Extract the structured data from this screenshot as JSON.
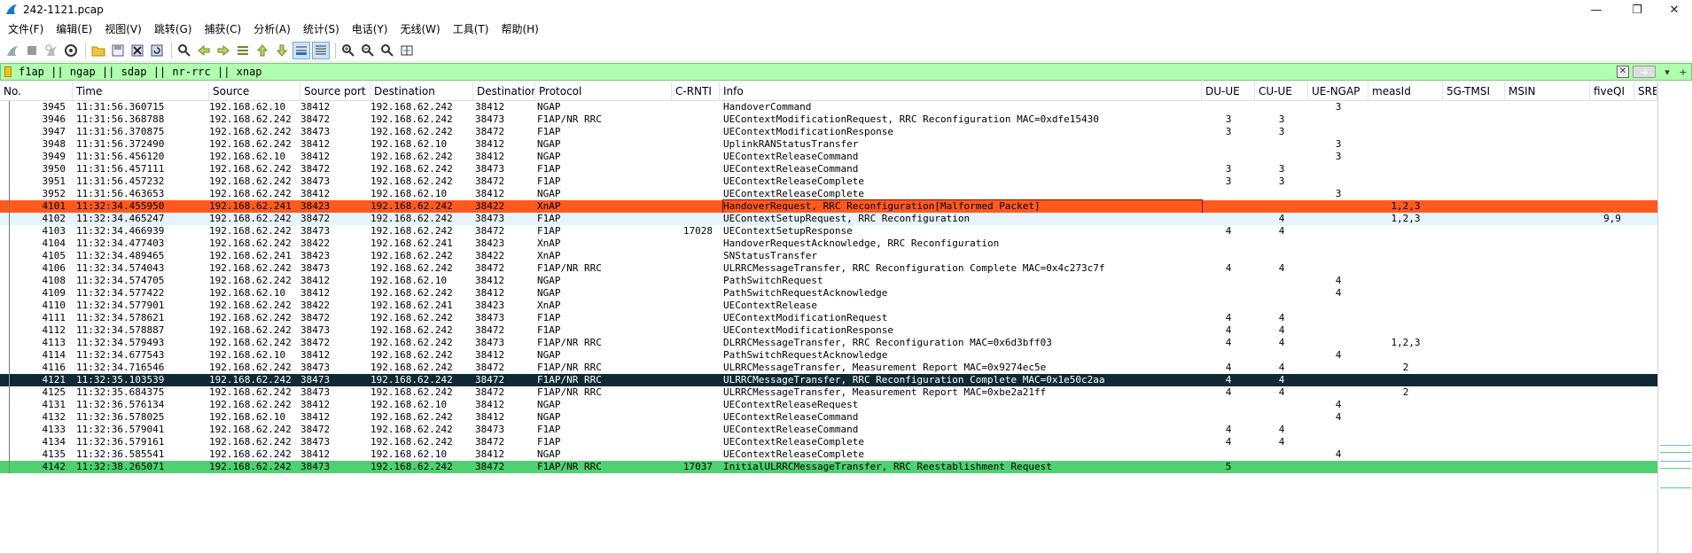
{
  "window": {
    "title": "242-1121.pcap",
    "minimize": "—",
    "restore": "❐",
    "close": "✕"
  },
  "menu": [
    "文件(F)",
    "编辑(E)",
    "视图(V)",
    "跳转(G)",
    "捕获(C)",
    "分析(A)",
    "统计(S)",
    "电话(Y)",
    "无线(W)",
    "工具(T)",
    "帮助(H)"
  ],
  "filter": {
    "value": "f1ap || ngap || sdap || nr-rrc || xnap",
    "background": "#afffaf"
  },
  "columns": [
    "No.",
    "Time",
    "Source",
    "Source port",
    "Destination",
    "Destination",
    "Protocol",
    "C-RNTI",
    "Info",
    "DU-UE",
    "CU-UE",
    "UE-NGAP",
    "measId",
    "5G-TMSI",
    "MSIN",
    "fiveQI",
    "SRB"
  ],
  "rows": [
    {
      "no": "3945",
      "time": "11:31:56.360715",
      "src": "192.168.62.10",
      "sport": "38412",
      "dst": "192.168.62.242",
      "dport": "38412",
      "proto": "NGAP",
      "crnti": "",
      "info": "HandoverCommand",
      "du": "",
      "cu": "",
      "ngap": "3",
      "meas": "",
      "tmsi": "",
      "msin": "",
      "fiveqi": "",
      "srb": "",
      "style": "normal"
    },
    {
      "no": "3946",
      "time": "11:31:56.368788",
      "src": "192.168.62.242",
      "sport": "38472",
      "dst": "192.168.62.242",
      "dport": "38473",
      "proto": "F1AP/NR RRC",
      "crnti": "",
      "info": "UEContextModificationRequest, RRC Reconfiguration MAC=0xdfe15430",
      "du": "3",
      "cu": "3",
      "ngap": "",
      "meas": "",
      "tmsi": "",
      "msin": "",
      "fiveqi": "",
      "srb": "",
      "style": "normal"
    },
    {
      "no": "3947",
      "time": "11:31:56.370875",
      "src": "192.168.62.242",
      "sport": "38473",
      "dst": "192.168.62.242",
      "dport": "38472",
      "proto": "F1AP",
      "crnti": "",
      "info": "UEContextModificationResponse",
      "du": "3",
      "cu": "3",
      "ngap": "",
      "meas": "",
      "tmsi": "",
      "msin": "",
      "fiveqi": "",
      "srb": "",
      "style": "normal"
    },
    {
      "no": "3948",
      "time": "11:31:56.372490",
      "src": "192.168.62.242",
      "sport": "38412",
      "dst": "192.168.62.10",
      "dport": "38412",
      "proto": "NGAP",
      "crnti": "",
      "info": "UplinkRANStatusTransfer",
      "du": "",
      "cu": "",
      "ngap": "3",
      "meas": "",
      "tmsi": "",
      "msin": "",
      "fiveqi": "",
      "srb": "",
      "style": "normal"
    },
    {
      "no": "3949",
      "time": "11:31:56.456120",
      "src": "192.168.62.10",
      "sport": "38412",
      "dst": "192.168.62.242",
      "dport": "38412",
      "proto": "NGAP",
      "crnti": "",
      "info": "UEContextReleaseCommand",
      "du": "",
      "cu": "",
      "ngap": "3",
      "meas": "",
      "tmsi": "",
      "msin": "",
      "fiveqi": "",
      "srb": "",
      "style": "normal"
    },
    {
      "no": "3950",
      "time": "11:31:56.457111",
      "src": "192.168.62.242",
      "sport": "38472",
      "dst": "192.168.62.242",
      "dport": "38473",
      "proto": "F1AP",
      "crnti": "",
      "info": "UEContextReleaseCommand",
      "du": "3",
      "cu": "3",
      "ngap": "",
      "meas": "",
      "tmsi": "",
      "msin": "",
      "fiveqi": "",
      "srb": "",
      "style": "normal"
    },
    {
      "no": "3951",
      "time": "11:31:56.457232",
      "src": "192.168.62.242",
      "sport": "38473",
      "dst": "192.168.62.242",
      "dport": "38472",
      "proto": "F1AP",
      "crnti": "",
      "info": "UEContextReleaseComplete",
      "du": "3",
      "cu": "3",
      "ngap": "",
      "meas": "",
      "tmsi": "",
      "msin": "",
      "fiveqi": "",
      "srb": "",
      "style": "normal"
    },
    {
      "no": "3952",
      "time": "11:31:56.463653",
      "src": "192.168.62.242",
      "sport": "38412",
      "dst": "192.168.62.10",
      "dport": "38412",
      "proto": "NGAP",
      "crnti": "",
      "info": "UEContextReleaseComplete",
      "du": "",
      "cu": "",
      "ngap": "3",
      "meas": "",
      "tmsi": "",
      "msin": "",
      "fiveqi": "",
      "srb": "",
      "style": "normal"
    },
    {
      "no": "4101",
      "time": "11:32:34.455950",
      "src": "192.168.62.241",
      "sport": "38423",
      "dst": "192.168.62.242",
      "dport": "38422",
      "proto": "XnAP",
      "crnti": "",
      "info": "HandoverRequest, RRC Reconfiguration[Malformed Packet]",
      "du": "",
      "cu": "",
      "ngap": "",
      "meas": "1,2,3",
      "tmsi": "",
      "msin": "",
      "fiveqi": "",
      "srb": "",
      "style": "orange"
    },
    {
      "no": "4102",
      "time": "11:32:34.465247",
      "src": "192.168.62.242",
      "sport": "38472",
      "dst": "192.168.62.242",
      "dport": "38473",
      "proto": "F1AP",
      "crnti": "",
      "info": "UEContextSetupRequest, RRC Reconfiguration",
      "du": "",
      "cu": "4",
      "ngap": "",
      "meas": "1,2,3",
      "tmsi": "",
      "msin": "",
      "fiveqi": "9,9",
      "srb": "",
      "style": "lightblue"
    },
    {
      "no": "4103",
      "time": "11:32:34.466939",
      "src": "192.168.62.242",
      "sport": "38473",
      "dst": "192.168.62.242",
      "dport": "38472",
      "proto": "F1AP",
      "crnti": "17028",
      "info": "UEContextSetupResponse",
      "du": "4",
      "cu": "4",
      "ngap": "",
      "meas": "",
      "tmsi": "",
      "msin": "",
      "fiveqi": "",
      "srb": "",
      "style": "normal"
    },
    {
      "no": "4104",
      "time": "11:32:34.477403",
      "src": "192.168.62.242",
      "sport": "38422",
      "dst": "192.168.62.241",
      "dport": "38423",
      "proto": "XnAP",
      "crnti": "",
      "info": "HandoverRequestAcknowledge, RRC Reconfiguration",
      "du": "",
      "cu": "",
      "ngap": "",
      "meas": "",
      "tmsi": "",
      "msin": "",
      "fiveqi": "",
      "srb": "",
      "style": "normal"
    },
    {
      "no": "4105",
      "time": "11:32:34.489465",
      "src": "192.168.62.241",
      "sport": "38423",
      "dst": "192.168.62.242",
      "dport": "38422",
      "proto": "XnAP",
      "crnti": "",
      "info": "SNStatusTransfer",
      "du": "",
      "cu": "",
      "ngap": "",
      "meas": "",
      "tmsi": "",
      "msin": "",
      "fiveqi": "",
      "srb": "",
      "style": "normal"
    },
    {
      "no": "4106",
      "time": "11:32:34.574043",
      "src": "192.168.62.242",
      "sport": "38473",
      "dst": "192.168.62.242",
      "dport": "38472",
      "proto": "F1AP/NR RRC",
      "crnti": "",
      "info": "ULRRCMessageTransfer, RRC Reconfiguration Complete MAC=0x4c273c7f",
      "du": "4",
      "cu": "4",
      "ngap": "",
      "meas": "",
      "tmsi": "",
      "msin": "",
      "fiveqi": "",
      "srb": "",
      "style": "normal"
    },
    {
      "no": "4108",
      "time": "11:32:34.574705",
      "src": "192.168.62.242",
      "sport": "38412",
      "dst": "192.168.62.10",
      "dport": "38412",
      "proto": "NGAP",
      "crnti": "",
      "info": "PathSwitchRequest",
      "du": "",
      "cu": "",
      "ngap": "4",
      "meas": "",
      "tmsi": "",
      "msin": "",
      "fiveqi": "",
      "srb": "",
      "style": "normal"
    },
    {
      "no": "4109",
      "time": "11:32:34.577422",
      "src": "192.168.62.10",
      "sport": "38412",
      "dst": "192.168.62.242",
      "dport": "38412",
      "proto": "NGAP",
      "crnti": "",
      "info": "PathSwitchRequestAcknowledge",
      "du": "",
      "cu": "",
      "ngap": "4",
      "meas": "",
      "tmsi": "",
      "msin": "",
      "fiveqi": "",
      "srb": "",
      "style": "normal"
    },
    {
      "no": "4110",
      "time": "11:32:34.577901",
      "src": "192.168.62.242",
      "sport": "38422",
      "dst": "192.168.62.241",
      "dport": "38423",
      "proto": "XnAP",
      "crnti": "",
      "info": "UEContextRelease",
      "du": "",
      "cu": "",
      "ngap": "",
      "meas": "",
      "tmsi": "",
      "msin": "",
      "fiveqi": "",
      "srb": "",
      "style": "normal"
    },
    {
      "no": "4111",
      "time": "11:32:34.578621",
      "src": "192.168.62.242",
      "sport": "38472",
      "dst": "192.168.62.242",
      "dport": "38473",
      "proto": "F1AP",
      "crnti": "",
      "info": "UEContextModificationRequest",
      "du": "4",
      "cu": "4",
      "ngap": "",
      "meas": "",
      "tmsi": "",
      "msin": "",
      "fiveqi": "",
      "srb": "",
      "style": "normal"
    },
    {
      "no": "4112",
      "time": "11:32:34.578887",
      "src": "192.168.62.242",
      "sport": "38473",
      "dst": "192.168.62.242",
      "dport": "38472",
      "proto": "F1AP",
      "crnti": "",
      "info": "UEContextModificationResponse",
      "du": "4",
      "cu": "4",
      "ngap": "",
      "meas": "",
      "tmsi": "",
      "msin": "",
      "fiveqi": "",
      "srb": "",
      "style": "normal"
    },
    {
      "no": "4113",
      "time": "11:32:34.579493",
      "src": "192.168.62.242",
      "sport": "38472",
      "dst": "192.168.62.242",
      "dport": "38473",
      "proto": "F1AP/NR RRC",
      "crnti": "",
      "info": "DLRRCMessageTransfer, RRC Reconfiguration MAC=0x6d3bff03",
      "du": "4",
      "cu": "4",
      "ngap": "",
      "meas": "1,2,3",
      "tmsi": "",
      "msin": "",
      "fiveqi": "",
      "srb": "",
      "style": "normal"
    },
    {
      "no": "4114",
      "time": "11:32:34.677543",
      "src": "192.168.62.10",
      "sport": "38412",
      "dst": "192.168.62.242",
      "dport": "38412",
      "proto": "NGAP",
      "crnti": "",
      "info": "PathSwitchRequestAcknowledge",
      "du": "",
      "cu": "",
      "ngap": "4",
      "meas": "",
      "tmsi": "",
      "msin": "",
      "fiveqi": "",
      "srb": "",
      "style": "normal"
    },
    {
      "no": "4116",
      "time": "11:32:34.716546",
      "src": "192.168.62.242",
      "sport": "38473",
      "dst": "192.168.62.242",
      "dport": "38472",
      "proto": "F1AP/NR RRC",
      "crnti": "",
      "info": "ULRRCMessageTransfer, Measurement Report MAC=0x9274ec5e",
      "du": "4",
      "cu": "4",
      "ngap": "",
      "meas": "2",
      "tmsi": "",
      "msin": "",
      "fiveqi": "",
      "srb": "",
      "style": "normal"
    },
    {
      "no": "4121",
      "time": "11:32:35.103539",
      "src": "192.168.62.242",
      "sport": "38473",
      "dst": "192.168.62.242",
      "dport": "38472",
      "proto": "F1AP/NR RRC",
      "crnti": "",
      "info": "ULRRCMessageTransfer, RRC Reconfiguration Complete MAC=0x1e50c2aa",
      "du": "4",
      "cu": "4",
      "ngap": "",
      "meas": "",
      "tmsi": "",
      "msin": "",
      "fiveqi": "",
      "srb": "",
      "style": "selected"
    },
    {
      "no": "4125",
      "time": "11:32:35.684375",
      "src": "192.168.62.242",
      "sport": "38473",
      "dst": "192.168.62.242",
      "dport": "38472",
      "proto": "F1AP/NR RRC",
      "crnti": "",
      "info": "ULRRCMessageTransfer, Measurement Report MAC=0xbe2a21ff",
      "du": "4",
      "cu": "4",
      "ngap": "",
      "meas": "2",
      "tmsi": "",
      "msin": "",
      "fiveqi": "",
      "srb": "",
      "style": "normal"
    },
    {
      "no": "4131",
      "time": "11:32:36.576134",
      "src": "192.168.62.242",
      "sport": "38412",
      "dst": "192.168.62.10",
      "dport": "38412",
      "proto": "NGAP",
      "crnti": "",
      "info": "UEContextReleaseRequest",
      "du": "",
      "cu": "",
      "ngap": "4",
      "meas": "",
      "tmsi": "",
      "msin": "",
      "fiveqi": "",
      "srb": "",
      "style": "normal"
    },
    {
      "no": "4132",
      "time": "11:32:36.578025",
      "src": "192.168.62.10",
      "sport": "38412",
      "dst": "192.168.62.242",
      "dport": "38412",
      "proto": "NGAP",
      "crnti": "",
      "info": "UEContextReleaseCommand",
      "du": "",
      "cu": "",
      "ngap": "4",
      "meas": "",
      "tmsi": "",
      "msin": "",
      "fiveqi": "",
      "srb": "",
      "style": "normal"
    },
    {
      "no": "4133",
      "time": "11:32:36.579041",
      "src": "192.168.62.242",
      "sport": "38472",
      "dst": "192.168.62.242",
      "dport": "38473",
      "proto": "F1AP",
      "crnti": "",
      "info": "UEContextReleaseCommand",
      "du": "4",
      "cu": "4",
      "ngap": "",
      "meas": "",
      "tmsi": "",
      "msin": "",
      "fiveqi": "",
      "srb": "",
      "style": "normal"
    },
    {
      "no": "4134",
      "time": "11:32:36.579161",
      "src": "192.168.62.242",
      "sport": "38473",
      "dst": "192.168.62.242",
      "dport": "38472",
      "proto": "F1AP",
      "crnti": "",
      "info": "UEContextReleaseComplete",
      "du": "4",
      "cu": "4",
      "ngap": "",
      "meas": "",
      "tmsi": "",
      "msin": "",
      "fiveqi": "",
      "srb": "",
      "style": "normal"
    },
    {
      "no": "4135",
      "time": "11:32:36.585541",
      "src": "192.168.62.242",
      "sport": "38412",
      "dst": "192.168.62.10",
      "dport": "38412",
      "proto": "NGAP",
      "crnti": "",
      "info": "UEContextReleaseComplete",
      "du": "",
      "cu": "",
      "ngap": "4",
      "meas": "",
      "tmsi": "",
      "msin": "",
      "fiveqi": "",
      "srb": "",
      "style": "normal"
    },
    {
      "no": "4142",
      "time": "11:32:38.265071",
      "src": "192.168.62.242",
      "sport": "38473",
      "dst": "192.168.62.242",
      "dport": "38472",
      "proto": "F1AP/NR RRC",
      "crnti": "17037",
      "info": "InitialULRRCMessageTransfer, RRC Reestablishment Request",
      "du": "5",
      "cu": "",
      "ngap": "",
      "meas": "",
      "tmsi": "",
      "msin": "",
      "fiveqi": "",
      "srb": "",
      "style": "green"
    }
  ],
  "row_colors": {
    "orange": "#ff5a1e",
    "lightblue": "#e7f3fd",
    "selected": "#102a35",
    "green": "#4ed16f"
  }
}
